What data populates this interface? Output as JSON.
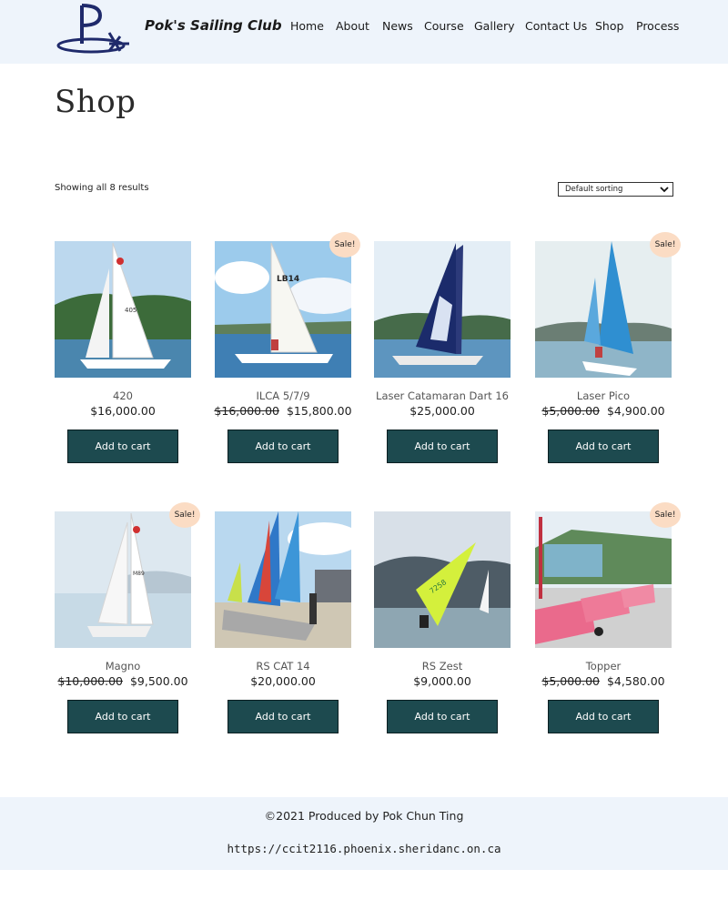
{
  "header": {
    "site_title": "Pok's Sailing Club",
    "nav": [
      "Home",
      "About",
      "News",
      "Course",
      "Gallery",
      "Contact Us",
      "Shop",
      "Process"
    ]
  },
  "page": {
    "title": "Shop"
  },
  "toolbar": {
    "result_count": "Showing all 8 results",
    "sort_selected": "Default sorting"
  },
  "products": [
    {
      "name": "420",
      "sale": false,
      "regular_price": "",
      "price": "$16,000.00",
      "badge": "",
      "button": "Add to cart",
      "image": "sailboat-white-420"
    },
    {
      "name": "ILCA 5/7/9",
      "sale": true,
      "regular_price": "$16,000.00",
      "price": "$15,800.00",
      "badge": "Sale!",
      "button": "Add to cart",
      "image": "sailboat-ilca"
    },
    {
      "name": "Laser Catamaran Dart 16",
      "sale": false,
      "regular_price": "",
      "price": "$25,000.00",
      "badge": "",
      "button": "Add to cart",
      "image": "catamaran-dart"
    },
    {
      "name": "Laser Pico",
      "sale": true,
      "regular_price": "$5,000.00",
      "price": "$4,900.00",
      "badge": "Sale!",
      "button": "Add to cart",
      "image": "sailboat-pico"
    },
    {
      "name": "Magno",
      "sale": true,
      "regular_price": "$10,000.00",
      "price": "$9,500.00",
      "badge": "Sale!",
      "button": "Add to cart",
      "image": "sailboat-magno"
    },
    {
      "name": "RS CAT 14",
      "sale": false,
      "regular_price": "",
      "price": "$20,000.00",
      "badge": "",
      "button": "Add to cart",
      "image": "catamaran-rs-cat"
    },
    {
      "name": "RS Zest",
      "sale": false,
      "regular_price": "",
      "price": "$9,000.00",
      "badge": "",
      "button": "Add to cart",
      "image": "sailboat-rs-zest"
    },
    {
      "name": "Topper",
      "sale": true,
      "regular_price": "$5,000.00",
      "price": "$4,580.00",
      "badge": "Sale!",
      "button": "Add to cart",
      "image": "dinghies-topper"
    }
  ],
  "footer": {
    "copyright": "©2021 Produced by Pok Chun Ting",
    "url": "https://ccit2116.phoenix.sheridanc.on.ca"
  },
  "colors": {
    "header_bg": "#eef4fb",
    "button_bg": "#1d4a4f",
    "sale_badge": "#fbdcc4"
  }
}
